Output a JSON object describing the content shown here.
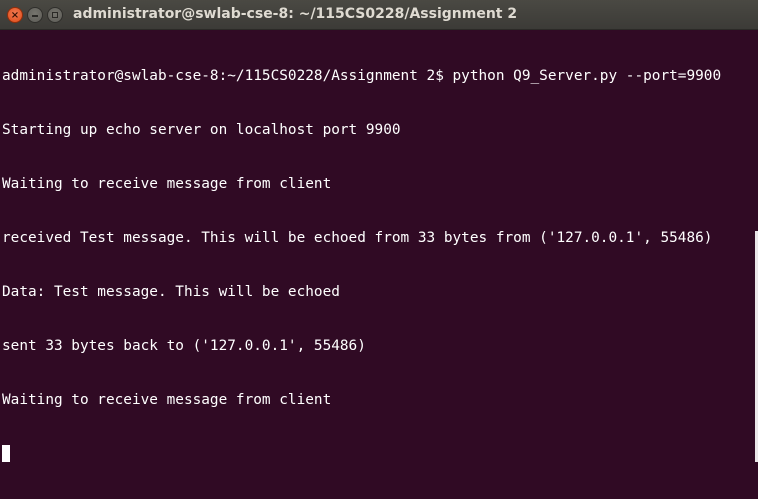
{
  "window": {
    "title": "administrator@swlab-cse-8: ~/115CS0228/Assignment 2",
    "buttons": {
      "close": "×",
      "minimize": "",
      "maximize": ""
    }
  },
  "terminal": {
    "lines": [
      "administrator@swlab-cse-8:~/115CS0228/Assignment 2$ python Q9_Server.py --port=9900",
      "Starting up echo server on localhost port 9900",
      "Waiting to receive message from client",
      "received Test message. This will be echoed from 33 bytes from ('127.0.0.1', 55486)",
      "Data: Test message. This will be echoed",
      "sent 33 bytes back to ('127.0.0.1', 55486)",
      "Waiting to receive message from client"
    ]
  },
  "colors": {
    "background": "#300a24",
    "text": "#ffffff",
    "titlebar": "#3c3b37",
    "close_button": "#df4a16"
  }
}
